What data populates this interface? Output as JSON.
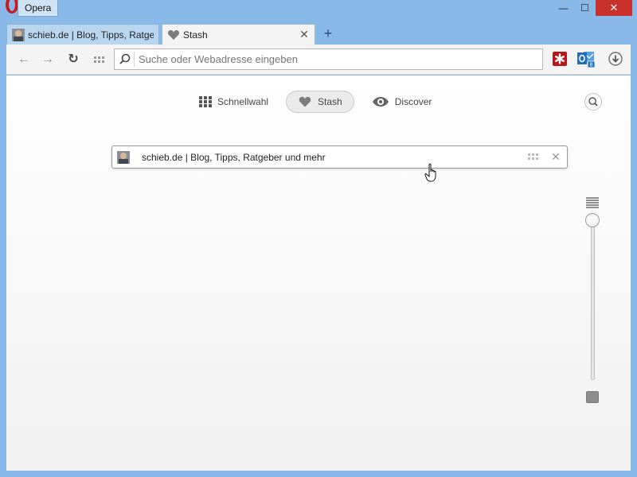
{
  "window": {
    "app_name": "Opera",
    "minimize_glyph": "—",
    "maximize_glyph": "☐",
    "close_glyph": "✕"
  },
  "tabs": [
    {
      "label": "schieb.de | Blog, Tipps, Ratgeber",
      "active": false,
      "icon": "avatar-favicon"
    },
    {
      "label": "Stash",
      "active": true,
      "icon": "heart-icon",
      "close_glyph": "✕"
    }
  ],
  "new_tab_glyph": "+",
  "toolbar": {
    "back_glyph": "←",
    "forward_glyph": "→",
    "reload_glyph": "↻",
    "address_placeholder": "Suche oder Webadresse eingeben",
    "address_value": ""
  },
  "speed_dial_nav": {
    "items": [
      {
        "label": "Schnellwahl",
        "icon": "grid-icon",
        "selected": false
      },
      {
        "label": "Stash",
        "icon": "heart-icon",
        "selected": true
      },
      {
        "label": "Discover",
        "icon": "eye-icon",
        "selected": false
      }
    ]
  },
  "stash": {
    "items": [
      {
        "title": "schieb.de | Blog, Tipps, Ratgeber und mehr",
        "remove_glyph": "✕"
      }
    ]
  },
  "zoom": {
    "level": 0.0
  },
  "colors": {
    "titlebar": "#88b9e8",
    "close_button": "#c7302b",
    "lastpass_red": "#b5171c",
    "outlook_blue": "#1f6fb8"
  }
}
